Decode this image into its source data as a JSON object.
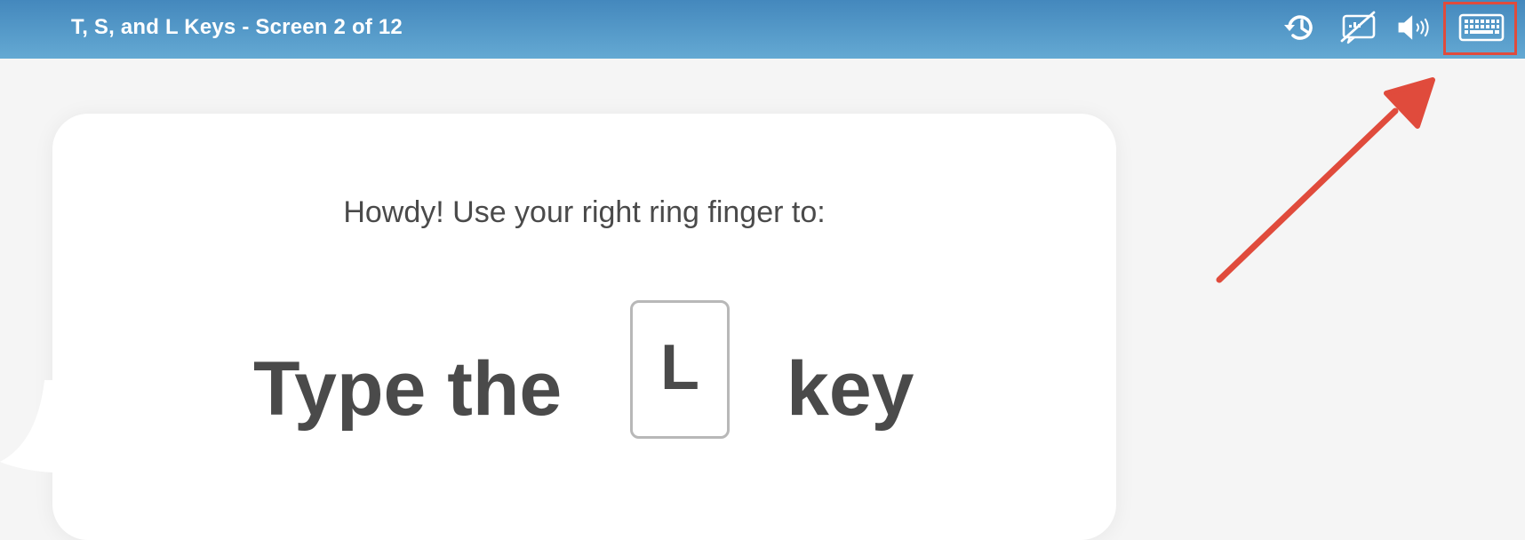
{
  "header": {
    "title": "T, S, and L Keys - Screen 2 of 12",
    "icons": [
      "history-icon",
      "closed-captions-off-icon",
      "speaker-icon",
      "keyboard-icon"
    ]
  },
  "lesson": {
    "instruction": "Howdy! Use your right ring finger to:",
    "prompt_before": "Type the",
    "key": "L",
    "prompt_after": "key"
  },
  "annotation": {
    "highlight_color": "#e04b3c",
    "target": "keyboard-icon"
  },
  "colors": {
    "header_top": "#4488bd",
    "header_bottom": "#64a9d3",
    "text": "#4a4a4a",
    "background": "#f5f5f5"
  }
}
